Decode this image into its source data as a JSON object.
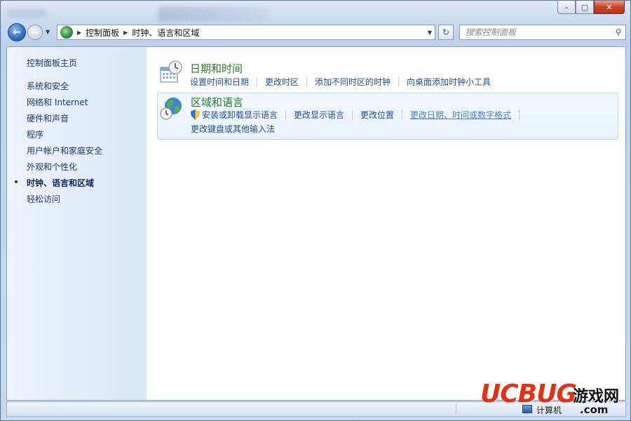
{
  "window": {
    "controls": {
      "minimize": "–",
      "maximize": "▢",
      "close": "✕"
    }
  },
  "nav": {
    "back_icon": "back-arrow-icon",
    "forward_icon": "forward-arrow-icon",
    "breadcrumb": [
      "控制面板",
      "时钟、语言和区域"
    ],
    "search_placeholder": "搜索控制面板"
  },
  "sidebar": {
    "home": "控制面板主页",
    "items": [
      {
        "label": "系统和安全",
        "active": false
      },
      {
        "label": "网络和 Internet",
        "active": false
      },
      {
        "label": "硬件和声音",
        "active": false
      },
      {
        "label": "程序",
        "active": false
      },
      {
        "label": "用户帐户和家庭安全",
        "active": false
      },
      {
        "label": "外观和个性化",
        "active": false
      },
      {
        "label": "时钟、语言和区域",
        "active": true
      },
      {
        "label": "轻松访问",
        "active": false
      }
    ]
  },
  "categories": [
    {
      "title": "日期和时间",
      "icon": "calendar-clock-icon",
      "links": [
        "设置时间和日期",
        "更改时区",
        "添加不同时区的时钟",
        "向桌面添加时钟小工具"
      ]
    },
    {
      "title": "区域和语言",
      "icon": "globe-clock-icon",
      "links": [
        "安装或卸载显示语言",
        "更改显示语言",
        "更改位置",
        "更改日期、时间或数字格式"
      ],
      "links_row2": [
        "更改键盘或其他输入法"
      ]
    }
  ],
  "statusbar": {
    "computer": "计算机"
  },
  "watermark": {
    "brand": "UCBUG",
    "cn": "游戏网",
    "domain": ".com"
  },
  "colors": {
    "category_title": "#1b7e2c",
    "link": "#1f4fa3",
    "visited_link": "#4b7fd0",
    "sidebar_text": "#1a3c78",
    "watermark_red": "#e53015"
  }
}
